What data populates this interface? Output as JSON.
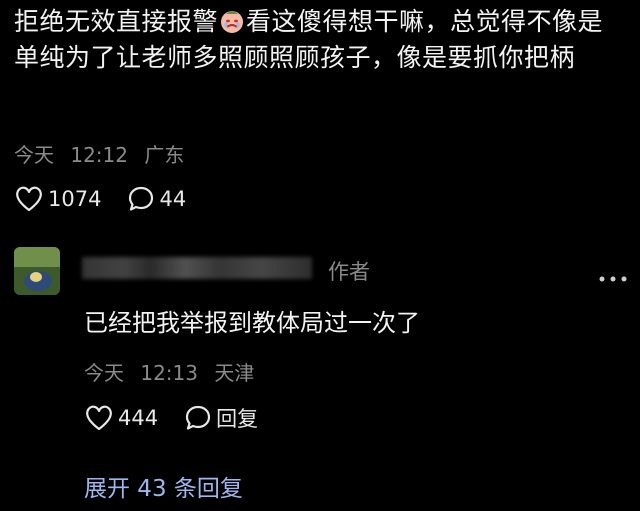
{
  "post": {
    "text_before_emoji": "拒绝无效直接报警",
    "text_after_emoji": "看这傻得想干嘛，总觉得不像是单纯为了让老师多照顾照顾孩子，像是要抓你把柄",
    "emoji_icon": "crying-face-icon",
    "date": "今天",
    "time": "12:12",
    "location": "广东",
    "likes": "1074",
    "comments": "44"
  },
  "reply": {
    "author_tag": "作者",
    "text": "已经把我举报到教体局过一次了",
    "date": "今天",
    "time": "12:13",
    "location": "天津",
    "likes": "444",
    "reply_label": "回复"
  },
  "expand_label": "展开 43 条回复",
  "colors": {
    "background": "#000000",
    "text": "#f3f3f3",
    "meta": "#8a8a8a",
    "link": "#9fb6ee"
  }
}
